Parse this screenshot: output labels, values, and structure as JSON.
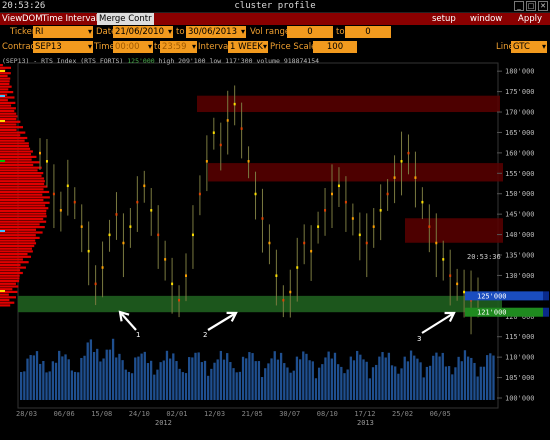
{
  "window": {
    "clock": "20:53:26",
    "title": "cluster profile"
  },
  "menu": {
    "view": "View",
    "dom": "DOM",
    "time_interval": "Time Interval",
    "merge": "Merge Contr",
    "setup": "setup",
    "window": "window",
    "apply": "Apply"
  },
  "toolbar1": {
    "ticker_label": "Ticker",
    "ticker": "RI",
    "date_label": "Date",
    "date_from": "21/06/2010",
    "to_label": "to",
    "date_to": "30/06/2013",
    "vol_label": "Vol range",
    "vol_from": "0",
    "vol_to_label": "to",
    "vol_to": "0"
  },
  "toolbar2": {
    "contract_label": "Contract",
    "contract": "SEP13",
    "time_label": "Time",
    "time_from": "00:00",
    "time_to_label": "to",
    "time_to": "23:59",
    "interval_label": "Interval",
    "interval": "1 WEEK",
    "scale_label": "Price Scale",
    "scale": "100",
    "line_label": "Line",
    "line": "GTC"
  },
  "info": {
    "symbol": "(SEP13) - RTS Index (RTS FORTS)",
    "last": "125'000",
    "high": "high 209'100",
    "low": "low 117'300",
    "volume": "volume 918874154"
  },
  "chart_data": {
    "type": "candlestick",
    "title": "",
    "y_ticks": [
      "180'000",
      "175'000",
      "170'000",
      "165'000",
      "160'000",
      "155'000",
      "150'000",
      "145'000",
      "140'000",
      "135'000",
      "130'000",
      "125'000",
      "120'000",
      "115'000",
      "110'000",
      "105'000",
      "100'000"
    ],
    "y_range": [
      100000,
      182000
    ],
    "x_ticks": [
      "28/03",
      "06/06",
      "15/08",
      "24/10",
      "02/01",
      "12/03",
      "21/05",
      "30/07",
      "08/10",
      "17/12",
      "25/02",
      "06/05"
    ],
    "x_year_labels": [
      "2012",
      "2013"
    ],
    "current_time_label": "20:53:36",
    "price_badges": [
      {
        "value": "125'000",
        "color": "#1a4dbf"
      },
      {
        "value": "121'000",
        "color": "#1f8a1f"
      }
    ],
    "resistance_zones": [
      {
        "from": 170000,
        "to": 174000
      },
      {
        "from": 153000,
        "to": 157500
      },
      {
        "from": 138000,
        "to": 144000
      }
    ],
    "support_zone": {
      "from": 121000,
      "to": 125000
    },
    "annotations": [
      "1",
      "2",
      "3"
    ],
    "weekly_closes": [
      160000,
      158000,
      150000,
      146000,
      152000,
      148000,
      142000,
      136000,
      128000,
      132000,
      140000,
      145000,
      138000,
      142000,
      148000,
      152000,
      146000,
      140000,
      134000,
      128000,
      124000,
      130000,
      140000,
      150000,
      158000,
      165000,
      162000,
      168000,
      172000,
      166000,
      158000,
      150000,
      144000,
      138000,
      130000,
      124000,
      126000,
      132000,
      138000,
      136000,
      142000,
      146000,
      150000,
      152000,
      148000,
      144000,
      140000,
      138000,
      142000,
      146000,
      150000,
      154000,
      158000,
      160000,
      154000,
      148000,
      142000,
      138000,
      134000,
      130000,
      128000,
      126000,
      124000,
      125000
    ]
  }
}
